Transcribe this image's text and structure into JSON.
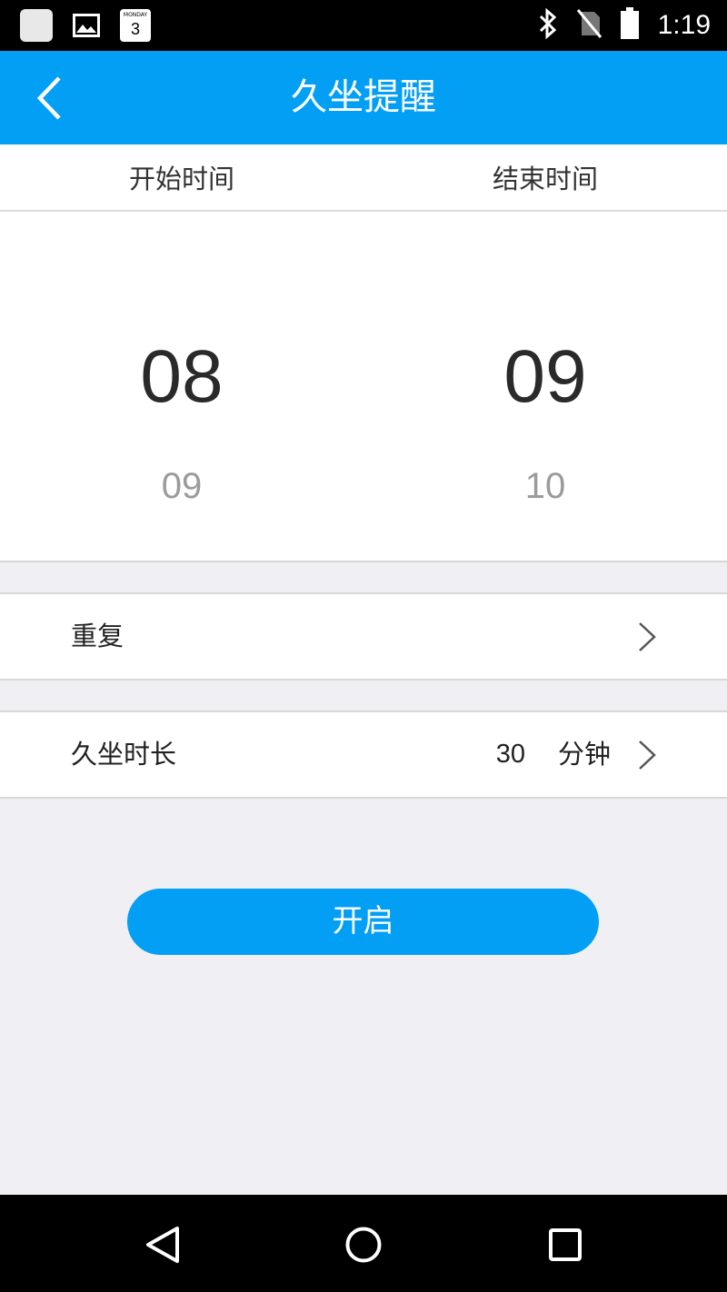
{
  "status_bar": {
    "time": "1:19",
    "calendar_weekday": "MONDAY",
    "calendar_day": "3",
    "icons": [
      "app-icon",
      "gallery-icon",
      "calendar-icon",
      "bluetooth-icon",
      "no-sim-icon",
      "battery-icon"
    ]
  },
  "header": {
    "title": "久坐提醒",
    "back_icon": "chevron-left-icon",
    "color": "#039ff5"
  },
  "columns": {
    "start_label": "开始时间",
    "end_label": "结束时间"
  },
  "picker": {
    "start": {
      "selected": "08",
      "next": "09"
    },
    "end": {
      "selected": "09",
      "next": "10"
    }
  },
  "repeat_row": {
    "label": "重复"
  },
  "duration_row": {
    "label": "久坐时长",
    "value": "30",
    "unit": "分钟"
  },
  "start_button": {
    "label": "开启"
  },
  "nav_bar": {
    "icons": [
      "back-triangle-icon",
      "home-circle-icon",
      "recents-square-icon"
    ]
  }
}
